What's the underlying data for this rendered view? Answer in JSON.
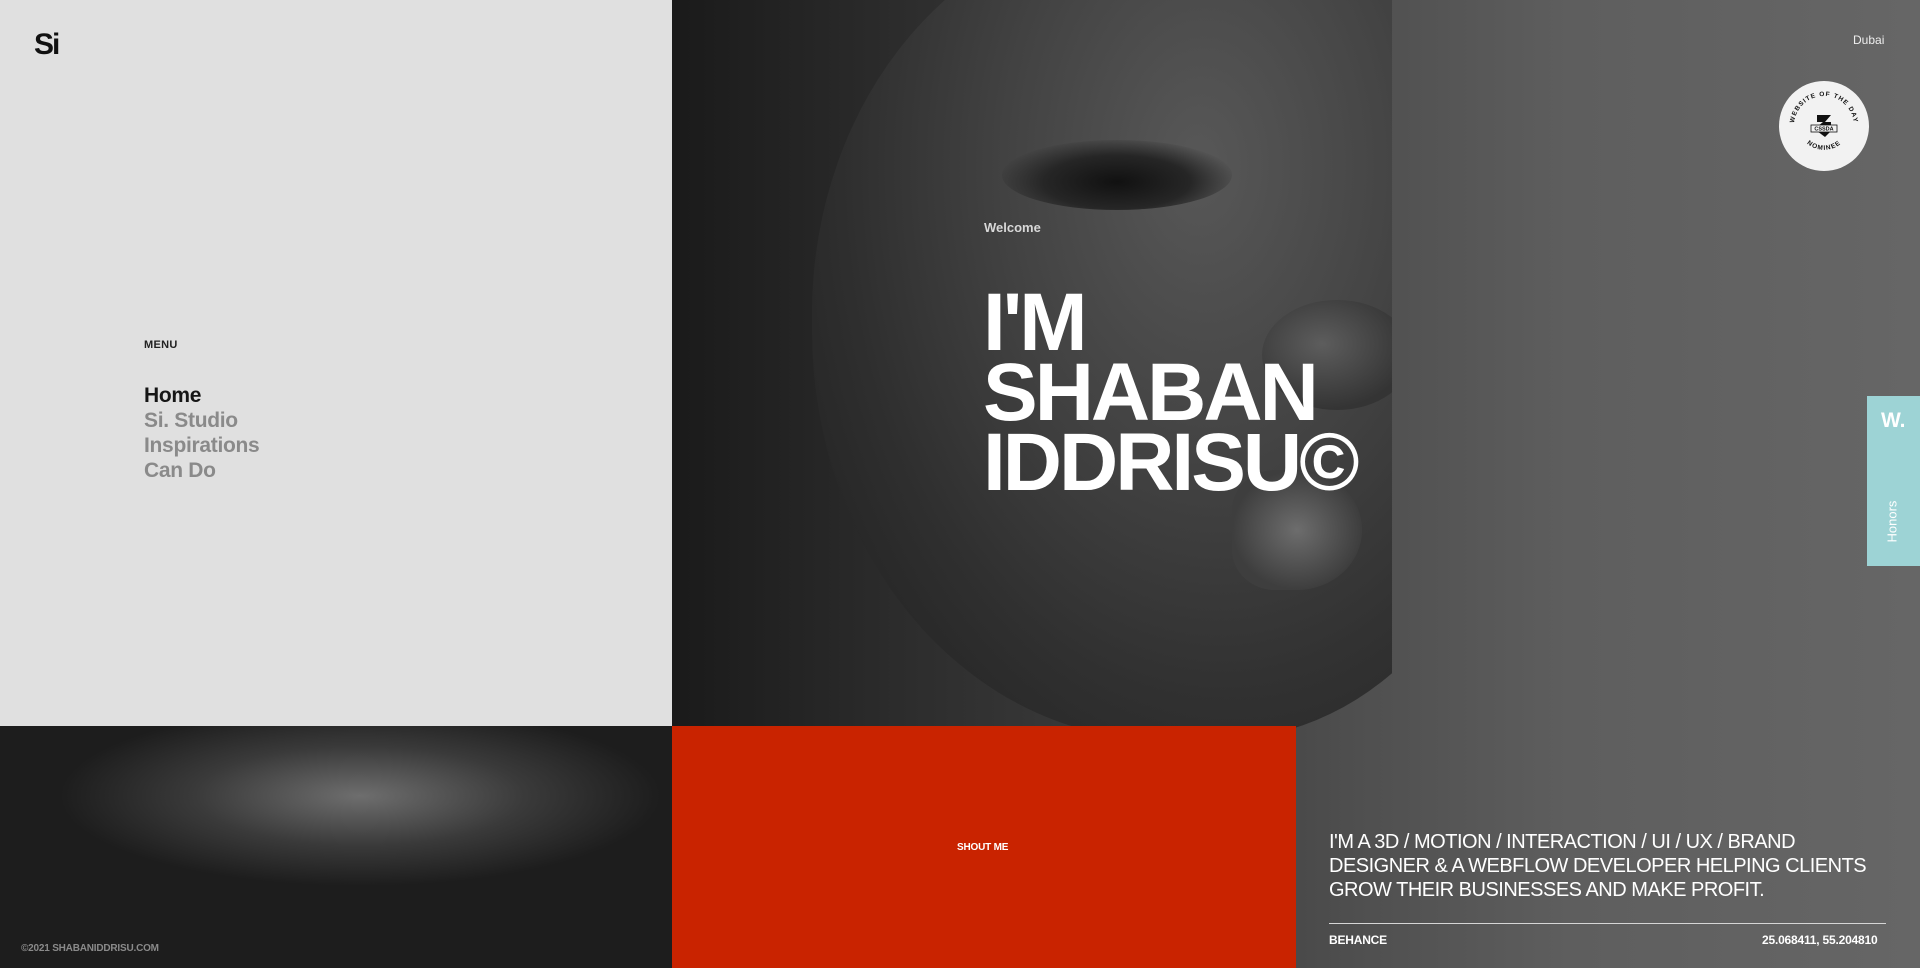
{
  "brand": {
    "logo": "Si"
  },
  "location": "Dubai",
  "menu": {
    "label": "MENU",
    "items": [
      {
        "label": "Home",
        "active": true
      },
      {
        "label": "Si. Studio",
        "active": false
      },
      {
        "label": "Inspirations",
        "active": false
      },
      {
        "label": "Can Do",
        "active": false
      }
    ]
  },
  "hero": {
    "welcome": "Welcome",
    "headline": [
      "I'M",
      "SHABAN",
      "IDDRISU©"
    ]
  },
  "badge": {
    "text_top": "WEBSITE OF THE DAY",
    "text_center": "CSSDA",
    "text_bottom": "NOMINEE"
  },
  "honors": {
    "logo": "W.",
    "label": "Honors",
    "color": "#9dd3d5"
  },
  "shout": {
    "label": "SHOUT ME",
    "color": "#c92300"
  },
  "about": {
    "text": "I'M A 3D / MOTION / INTERACTION / UI / UX / BRAND DESIGNER & A WEBFLOW DEVELOPER HELPING CLIENTS GROW THEIR BUSINESSES AND MAKE PROFIT."
  },
  "footer": {
    "behance": "BEHANCE",
    "coordinates": "25.068411, 55.204810",
    "copyright": "©2021 SHABANIDDRISU.COM"
  }
}
